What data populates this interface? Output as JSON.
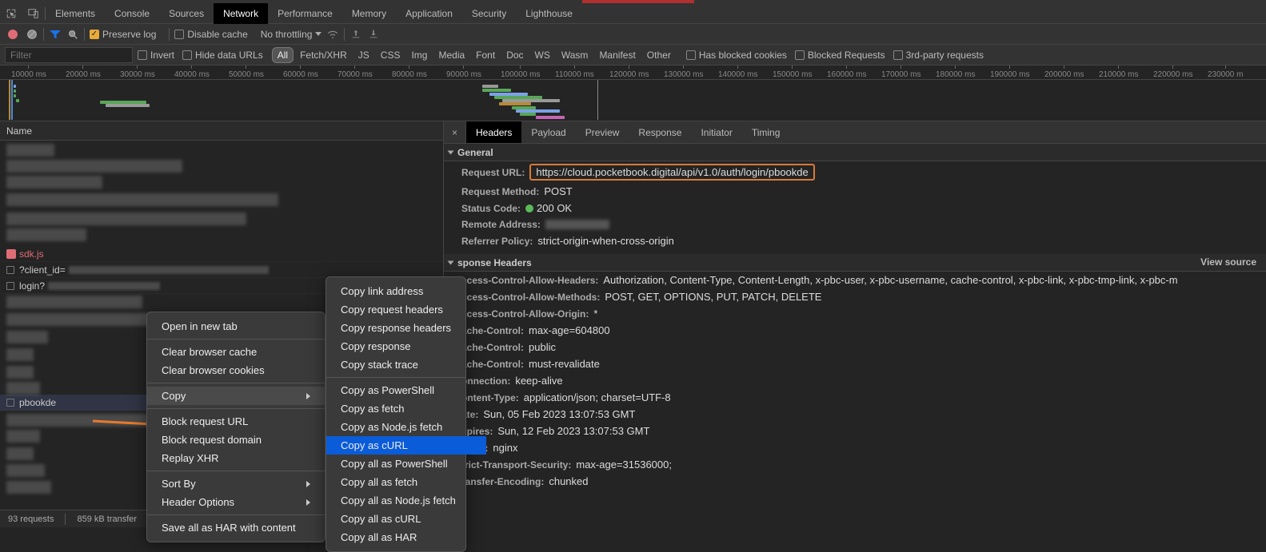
{
  "panelTabs": {
    "items": [
      "Elements",
      "Console",
      "Sources",
      "Network",
      "Performance",
      "Memory",
      "Application",
      "Security",
      "Lighthouse"
    ],
    "active": "Network"
  },
  "netToolbar": {
    "preserveLog": "Preserve log",
    "disableCache": "Disable cache",
    "throttling": "No throttling"
  },
  "filterRow": {
    "placeholder": "Filter",
    "invert": "Invert",
    "hideData": "Hide data URLs",
    "types": [
      "All",
      "Fetch/XHR",
      "JS",
      "CSS",
      "Img",
      "Media",
      "Font",
      "Doc",
      "WS",
      "Wasm",
      "Manifest",
      "Other"
    ],
    "activeType": "All",
    "hasBlocked": "Has blocked cookies",
    "blockedReq": "Blocked Requests",
    "thirdParty": "3rd-party requests"
  },
  "timeline": {
    "ticks": [
      "10000 ms",
      "20000 ms",
      "30000 ms",
      "40000 ms",
      "50000 ms",
      "60000 ms",
      "70000 ms",
      "80000 ms",
      "90000 ms",
      "100000 ms",
      "110000 ms",
      "120000 ms",
      "130000 ms",
      "140000 ms",
      "150000 ms",
      "160000 ms",
      "170000 ms",
      "180000 ms",
      "190000 ms",
      "200000 ms",
      "210000 ms",
      "220000 ms",
      "230000 m"
    ]
  },
  "leftPane": {
    "header": "Name",
    "sdk": "sdk.js",
    "clientId": "?client_id=",
    "login": "login?",
    "pbookde": "pbookde",
    "footer": {
      "requests": "93 requests",
      "transfer": "859 kB transfer"
    }
  },
  "detailTabs": {
    "items": [
      "Headers",
      "Payload",
      "Preview",
      "Response",
      "Initiator",
      "Timing"
    ],
    "active": "Headers"
  },
  "general": {
    "title": "General",
    "url_k": "Request URL:",
    "url_v": "https://cloud.pocketbook.digital/api/v1.0/auth/login/pbookde",
    "method_k": "Request Method:",
    "method_v": "POST",
    "status_k": "Status Code:",
    "status_v": "200 OK",
    "remote_k": "Remote Address:",
    "referrer_k": "Referrer Policy:",
    "referrer_v": "strict-origin-when-cross-origin"
  },
  "respHeaders": {
    "title": "sponse Headers",
    "viewSource": "View source",
    "lines": [
      {
        "k": "ccess-Control-Allow-Headers:",
        "v": "Authorization, Content-Type, Content-Length, x-pbc-user, x-pbc-username, cache-control, x-pbc-link, x-pbc-tmp-link, x-pbc-m"
      },
      {
        "k": "ccess-Control-Allow-Methods:",
        "v": "POST, GET, OPTIONS, PUT, PATCH, DELETE"
      },
      {
        "k": "ccess-Control-Allow-Origin:",
        "v": "*"
      },
      {
        "k": "ache-Control:",
        "v": "max-age=604800"
      },
      {
        "k": "ache-Control:",
        "v": "public"
      },
      {
        "k": "ache-Control:",
        "v": "must-revalidate"
      },
      {
        "k": "onnection:",
        "v": "keep-alive"
      },
      {
        "k": "ontent-Type:",
        "v": "application/json; charset=UTF-8"
      },
      {
        "k": "ate:",
        "v": "Sun, 05 Feb 2023 13:07:53 GMT"
      },
      {
        "k": "xpires:",
        "v": "Sun, 12 Feb 2023 13:07:53 GMT"
      },
      {
        "k": "erver:",
        "v": "nginx"
      },
      {
        "k": "trict-Transport-Security:",
        "v": "max-age=31536000;"
      },
      {
        "k": "ransfer-Encoding:",
        "v": "chunked"
      }
    ]
  },
  "ctxMain": {
    "open": "Open in new tab",
    "clearCache": "Clear browser cache",
    "clearCookies": "Clear browser cookies",
    "copy": "Copy",
    "blockUrl": "Block request URL",
    "blockDomain": "Block request domain",
    "replay": "Replay XHR",
    "sort": "Sort By",
    "headerOpts": "Header Options",
    "saveHar": "Save all as HAR with content"
  },
  "ctxCopy": {
    "items": [
      "Copy link address",
      "Copy request headers",
      "Copy response headers",
      "Copy response",
      "Copy stack trace",
      "-",
      "Copy as PowerShell",
      "Copy as fetch",
      "Copy as Node.js fetch",
      "Copy as cURL",
      "Copy all as PowerShell",
      "Copy all as fetch",
      "Copy all as Node.js fetch",
      "Copy all as cURL",
      "Copy all as HAR"
    ],
    "highlight": "Copy as cURL"
  }
}
